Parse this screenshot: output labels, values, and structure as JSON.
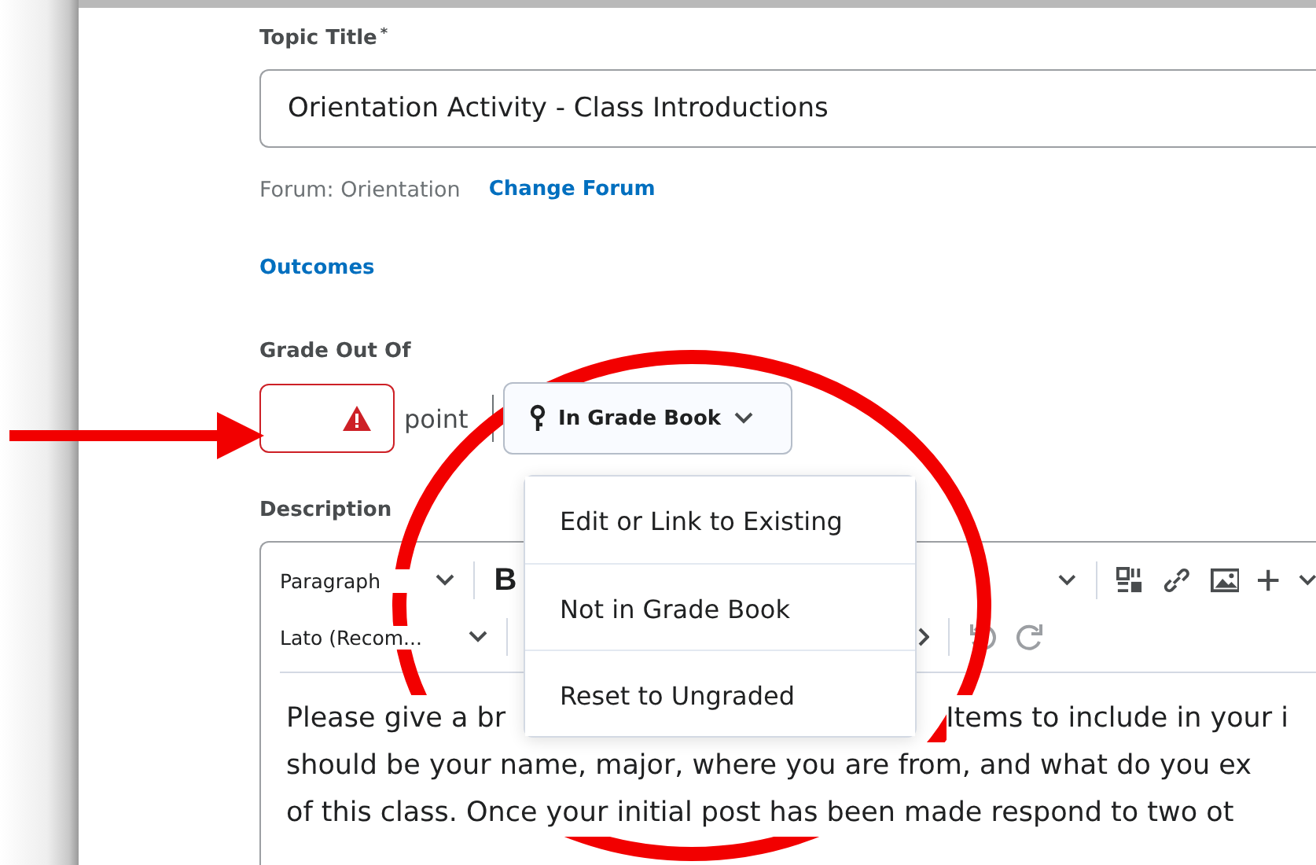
{
  "topic_title": {
    "label": "Topic Title",
    "required_mark": "*",
    "value": "Orientation Activity - Class Introductions"
  },
  "forum": {
    "label": "Forum: Orientation",
    "change_link": "Change Forum"
  },
  "outcomes_link": "Outcomes",
  "grade": {
    "label": "Grade Out Of",
    "invalid": true,
    "unit": "point",
    "grade_book_button": "In Grade Book",
    "menu_open": true,
    "menu_items": [
      {
        "label": "Edit or Link to Existing"
      },
      {
        "label": "Not in Grade Book"
      },
      {
        "label": "Reset to Ungraded"
      }
    ]
  },
  "description": {
    "label": "Description",
    "format_select": "Paragraph",
    "bold_button": "B",
    "font_select": "Lato (Recom...",
    "lines": [
      [
        "Please give a br",
        "Items to include in your i"
      ],
      [
        "should be your name, major, where you are from, and what do you ex"
      ],
      [
        "of this class. Once your initial post has been made respond to two ot"
      ]
    ]
  }
}
